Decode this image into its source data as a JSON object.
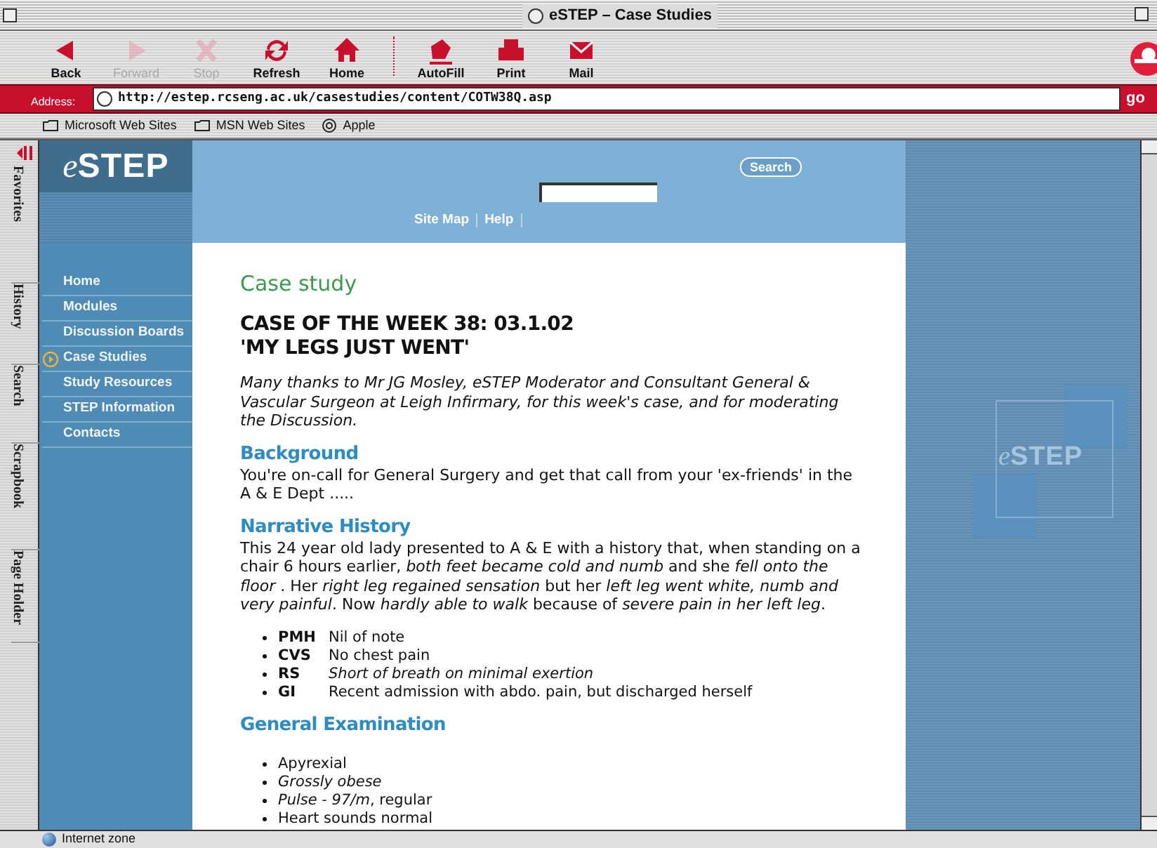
{
  "window": {
    "title": "eSTEP – Case Studies"
  },
  "toolbar": {
    "buttons": [
      {
        "label": "Back",
        "kind": "back",
        "disabled": false
      },
      {
        "label": "Forward",
        "kind": "forward",
        "disabled": true
      },
      {
        "label": "Stop",
        "kind": "stop",
        "disabled": true
      },
      {
        "label": "Refresh",
        "kind": "refresh",
        "disabled": false
      },
      {
        "label": "Home",
        "kind": "home",
        "disabled": false
      },
      {
        "label": "AutoFill",
        "kind": "autofill",
        "disabled": false
      },
      {
        "label": "Print",
        "kind": "print",
        "disabled": false
      },
      {
        "label": "Mail",
        "kind": "mail",
        "disabled": false
      }
    ]
  },
  "address_bar": {
    "label": "Address:",
    "value": "http://estep.rcseng.ac.uk/casestudies/content/COTW38Q.asp",
    "go": "go"
  },
  "favorites_bar": [
    {
      "label": "Microsoft Web Sites",
      "kind": "folder"
    },
    {
      "label": "MSN Web Sites",
      "kind": "folder"
    },
    {
      "label": "Apple",
      "kind": "site"
    }
  ],
  "explorer_tabs": [
    "Favorites",
    "History",
    "Search",
    "Scrapbook",
    "Page Holder"
  ],
  "site": {
    "logo": {
      "prefix": "e",
      "main": "STEP"
    },
    "search_button": "Search",
    "header_links": [
      "Site Map",
      "Help"
    ],
    "nav": [
      {
        "label": "Home",
        "selected": false
      },
      {
        "label": "Modules",
        "selected": false
      },
      {
        "label": "Discussion Boards",
        "selected": false
      },
      {
        "label": "Case Studies",
        "selected": true
      },
      {
        "label": "Study Resources",
        "selected": false
      },
      {
        "label": "STEP Information",
        "selected": false
      },
      {
        "label": "Contacts",
        "selected": false
      }
    ],
    "watermark": {
      "prefix": "e",
      "main": "STEP"
    }
  },
  "content": {
    "heading": "Case study",
    "title_lines": [
      "CASE OF THE WEEK 38: 03.1.02",
      "'MY LEGS JUST WENT'"
    ],
    "intro": "Many thanks to Mr JG Mosley, eSTEP Moderator and Consultant General & Vascular Surgeon at Leigh Infirmary, for this week's case, and for moderating the Discussion.",
    "sections": [
      {
        "heading": "Background",
        "paragraph": "You're on-call for General Surgery and get that call from your 'ex-friends' in the A & E Dept ....."
      },
      {
        "heading": "Narrative History",
        "paragraph": "This 24 year old lady presented to A & E with a history that, when standing on a chair 6 hours earlier, *both feet became cold and numb* and she *fell onto the floor* . Her *right leg regained sensation* but her *left leg went white, numb and very painful*. Now *hardly able to walk* because of *severe pain in her left leg*.",
        "items": [
          {
            "term": "PMH",
            "text": "Nil of note",
            "italic": false
          },
          {
            "term": "CVS",
            "text": "No chest pain",
            "italic": false
          },
          {
            "term": "RS",
            "text": "Short of breath on minimal exertion",
            "italic": true
          },
          {
            "term": "GI",
            "text": "Recent admission with abdo. pain, but discharged herself",
            "italic": false
          }
        ]
      },
      {
        "heading": "General Examination",
        "items": [
          {
            "text": "Apyrexial",
            "italic": false
          },
          {
            "text": "Grossly obese",
            "italic": true
          },
          {
            "text": "*Pulse - 97/m*, regular",
            "italic": false
          },
          {
            "text": "Heart sounds normal",
            "italic": false
          }
        ]
      }
    ]
  },
  "status_bar": {
    "zone": "Internet zone"
  }
}
